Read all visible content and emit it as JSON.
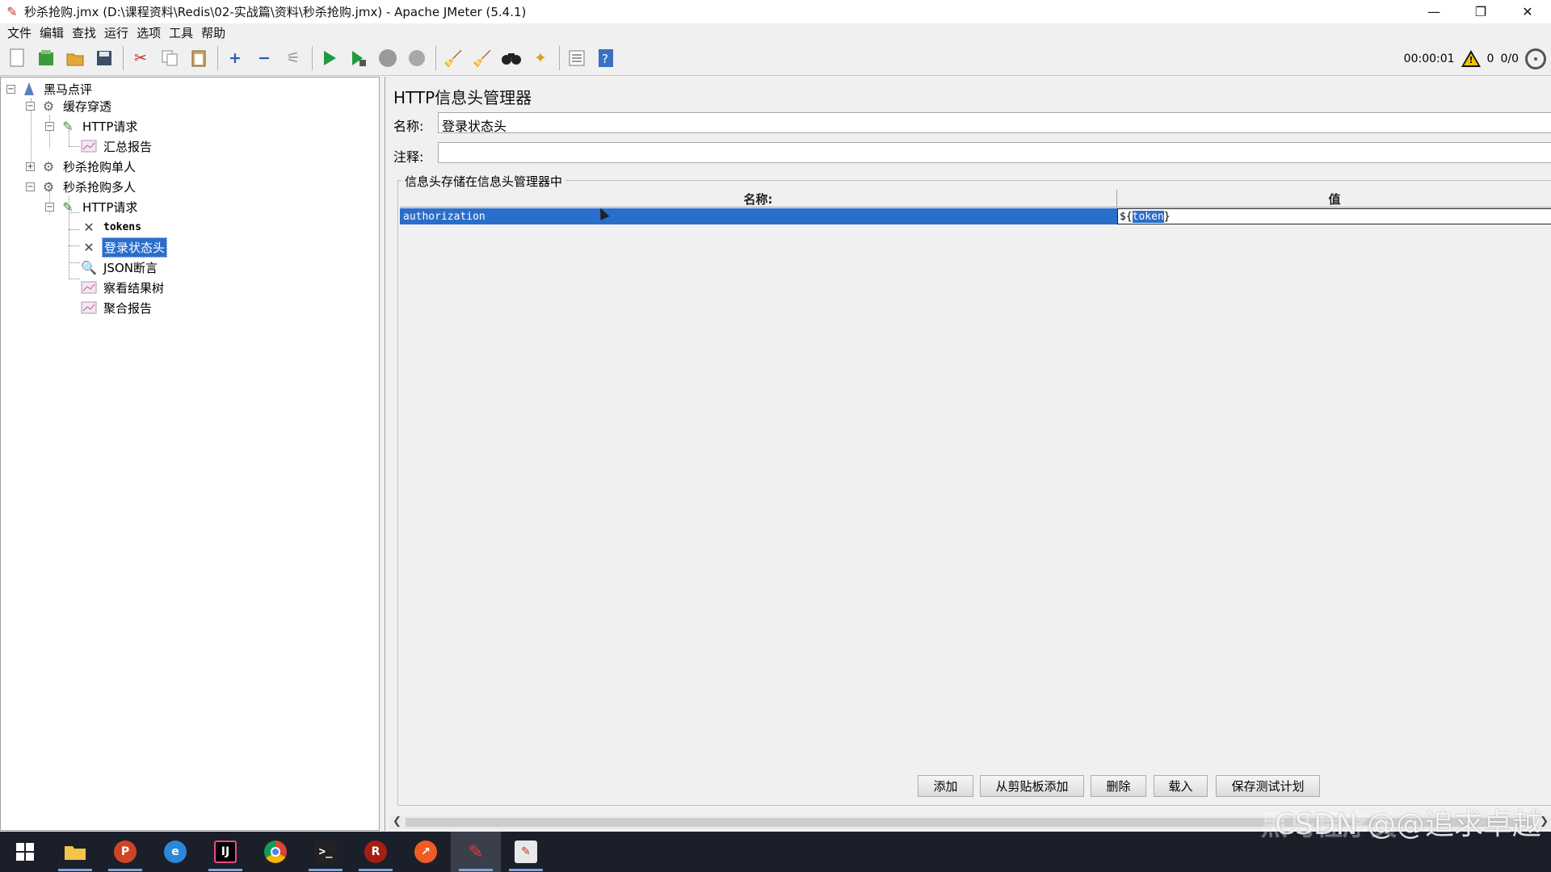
{
  "window": {
    "title": "秒杀抢购.jmx (D:\\课程资料\\Redis\\02-实战篇\\资料\\秒杀抢购.jmx) - Apache JMeter (5.4.1)",
    "minimize": "—",
    "restore": "❐",
    "close": "✕"
  },
  "menu": [
    "文件",
    "编辑",
    "查找",
    "运行",
    "选项",
    "工具",
    "帮助"
  ],
  "toolbar": {
    "elapsed": "00:00:01",
    "warnings": "0",
    "threads": "0/0"
  },
  "tree": [
    {
      "label": "黑马点评",
      "exp": "−"
    },
    {
      "label": "缓存穿透",
      "exp": "−"
    },
    {
      "label": "HTTP请求",
      "exp": "−"
    },
    {
      "label": "汇总报告"
    },
    {
      "label": "秒杀抢购单人",
      "exp": "+"
    },
    {
      "label": "秒杀抢购多人",
      "exp": "−"
    },
    {
      "label": "HTTP请求",
      "exp": "−"
    },
    {
      "label": "tokens"
    },
    {
      "label": "登录状态头",
      "selected": true
    },
    {
      "label": "JSON断言"
    },
    {
      "label": "察看结果树"
    },
    {
      "label": "聚合报告"
    }
  ],
  "panel": {
    "title": "HTTP信息头管理器",
    "name_label": "名称:",
    "name_value": "登录状态头",
    "comment_label": "注释:",
    "comment_value": "",
    "group_title": "信息头存储在信息头管理器中",
    "columns": [
      "名称:",
      "值"
    ],
    "rows": [
      {
        "name": "authorization",
        "value_prefix": "${",
        "value_selected": "token",
        "value_suffix": "}"
      }
    ],
    "buttons": [
      "添加",
      "从剪贴板添加",
      "删除",
      "载入",
      "保存测试计划"
    ]
  },
  "watermark": {
    "faint": "黑马程序员",
    "main": "CSDN @@追求卓越"
  },
  "colors": {
    "selection": "#2a6ecc",
    "taskbar": "#1b1f2a"
  }
}
